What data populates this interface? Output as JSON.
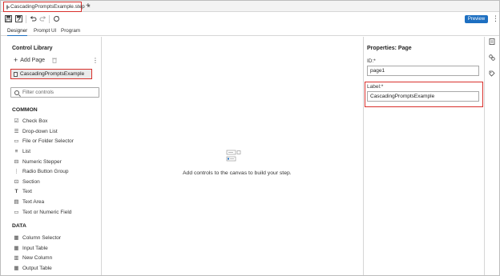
{
  "tabbar": {
    "tab_title": "CascadingPromptsExample.step",
    "close_glyph": "×",
    "new_tab_glyph": "+"
  },
  "toolbar": {
    "preview_label": "Preview",
    "kebab_glyph": "⋮",
    "icons": [
      "save-icon",
      "save-as-icon",
      "undo-icon",
      "redo-icon",
      "refresh-icon"
    ]
  },
  "subtabs": {
    "designer": "Designer",
    "prompt_ui": "Prompt UI",
    "program": "Program"
  },
  "left_panel": {
    "title": "Control Library",
    "add_page": "Add Page",
    "kebab_glyph": "⋮",
    "page_item": "CascadingPromptsExample",
    "filter_placeholder": "Filter controls",
    "common_heading": "COMMON",
    "common_controls": [
      {
        "label": "Check Box",
        "icon": "checkbox-icon"
      },
      {
        "label": "Drop-down List",
        "icon": "dropdown-list-icon"
      },
      {
        "label": "File or Folder Selector",
        "icon": "file-folder-icon"
      },
      {
        "label": "List",
        "icon": "list-icon"
      },
      {
        "label": "Numeric Stepper",
        "icon": "numeric-stepper-icon"
      },
      {
        "label": "Radio Button Group",
        "icon": "radio-group-icon"
      },
      {
        "label": "Section",
        "icon": "section-icon"
      },
      {
        "label": "Text",
        "icon": "text-icon"
      },
      {
        "label": "Text Area",
        "icon": "text-area-icon"
      },
      {
        "label": "Text or Numeric Field",
        "icon": "text-field-icon"
      }
    ],
    "data_heading": "DATA",
    "data_controls": [
      {
        "label": "Column Selector",
        "icon": "column-selector-icon"
      },
      {
        "label": "Input Table",
        "icon": "input-table-icon"
      },
      {
        "label": "New Column",
        "icon": "new-column-icon"
      },
      {
        "label": "Output Table",
        "icon": "output-table-icon"
      }
    ]
  },
  "canvas": {
    "empty_message": "Add controls to the canvas to build your step."
  },
  "properties": {
    "title": "Properties: Page",
    "id_label": "ID:*",
    "id_value": "page1",
    "label_label": "Label:*",
    "label_value": "CascadingPromptsExample"
  },
  "colors": {
    "accent": "#1d6fc1",
    "highlight_border": "#d9302c"
  }
}
